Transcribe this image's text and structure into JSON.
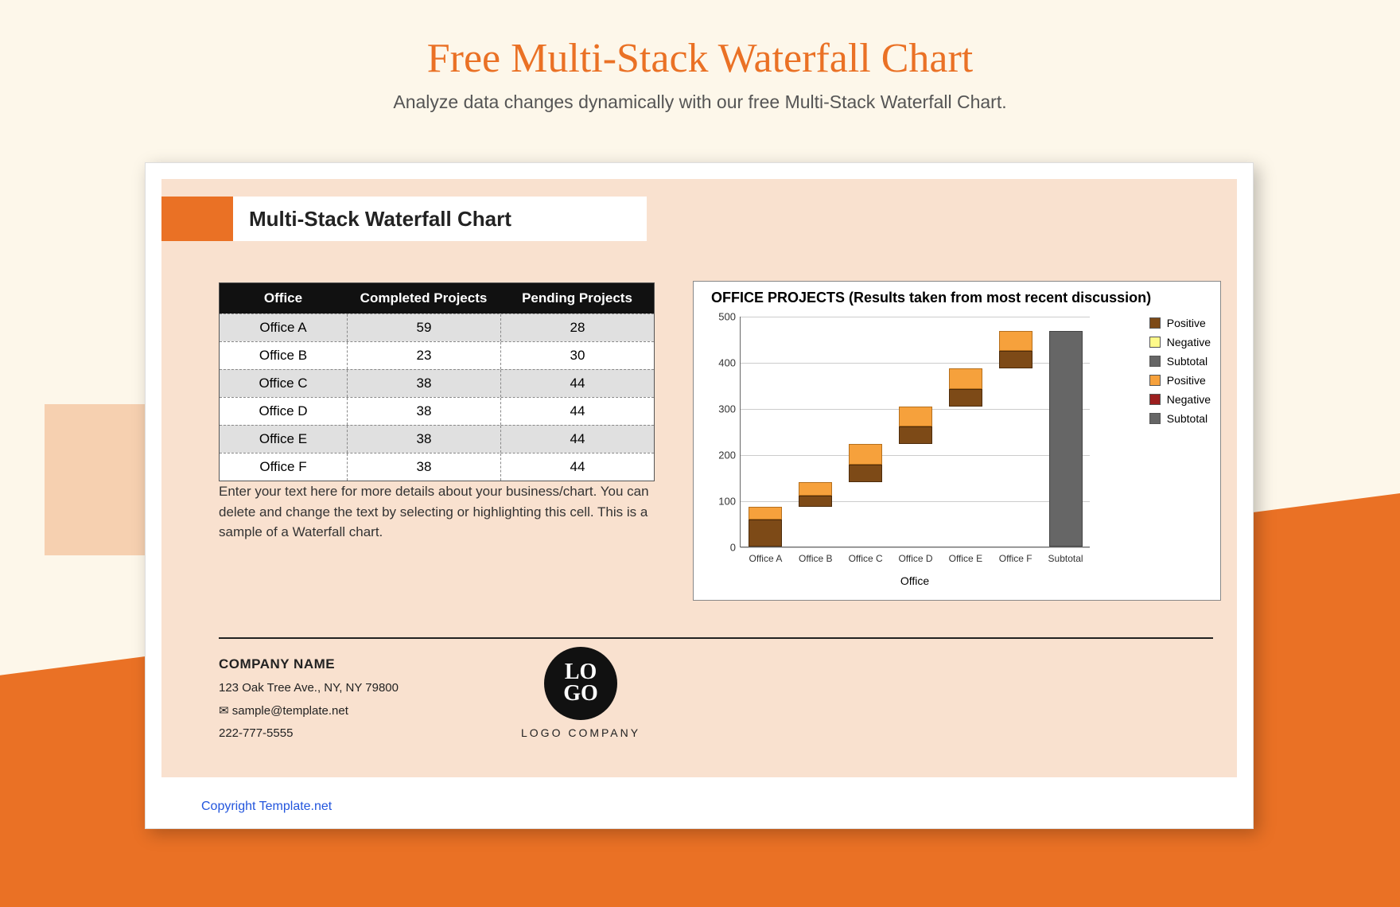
{
  "page": {
    "title": "Free Multi-Stack Waterfall Chart",
    "subtitle": "Analyze data changes dynamically with our free Multi-Stack Waterfall Chart."
  },
  "banner": {
    "label": "Multi-Stack Waterfall Chart"
  },
  "table": {
    "headers": [
      "Office",
      "Completed Projects",
      "Pending Projects"
    ],
    "rows": [
      {
        "office": "Office A",
        "completed": 59,
        "pending": 28
      },
      {
        "office": "Office B",
        "completed": 23,
        "pending": 30
      },
      {
        "office": "Office C",
        "completed": 38,
        "pending": 44
      },
      {
        "office": "Office D",
        "completed": 38,
        "pending": 44
      },
      {
        "office": "Office E",
        "completed": 38,
        "pending": 44
      },
      {
        "office": "Office F",
        "completed": 38,
        "pending": 44
      }
    ]
  },
  "note": "Enter your text here for more details about your business/chart. You can delete and change the text by selecting or highlighting this cell. This is a sample of a Waterfall chart.",
  "chart": {
    "title": "OFFICE PROJECTS (Results taken from most recent discussion)",
    "xaxis": "Office",
    "legend": [
      "Positive",
      "Negative",
      "Subtotal",
      "Positive",
      "Negative",
      "Subtotal"
    ]
  },
  "chart_data": {
    "type": "bar",
    "title": "OFFICE PROJECTS (Results taken from most recent discussion)",
    "xlabel": "Office",
    "ylabel": "",
    "ylim": [
      0,
      500
    ],
    "yticks": [
      0,
      100,
      200,
      300,
      400,
      500
    ],
    "categories": [
      "Office A",
      "Office B",
      "Office C",
      "Office D",
      "Office E",
      "Office F",
      "Subtotal"
    ],
    "series": [
      {
        "name": "Completed Projects (Positive)",
        "color": "#7d4a17",
        "values": [
          59,
          23,
          38,
          38,
          38,
          38,
          null
        ]
      },
      {
        "name": "Pending Projects (Positive)",
        "color": "#f6a13c",
        "values": [
          28,
          30,
          44,
          44,
          44,
          44,
          null
        ]
      },
      {
        "name": "Subtotal",
        "color": "#666666",
        "values": [
          null,
          null,
          null,
          null,
          null,
          null,
          468
        ]
      }
    ],
    "waterfall_bases": [
      0,
      87,
      140,
      222,
      304,
      386,
      0
    ],
    "legend_items": [
      {
        "name": "Positive",
        "color": "#7d4a17"
      },
      {
        "name": "Negative",
        "color": "#fffa8a"
      },
      {
        "name": "Subtotal",
        "color": "#666666"
      },
      {
        "name": "Positive",
        "color": "#f6a13c"
      },
      {
        "name": "Negative",
        "color": "#9c1f1f"
      },
      {
        "name": "Subtotal",
        "color": "#666666"
      }
    ]
  },
  "footer": {
    "company": "COMPANY NAME",
    "address": "123 Oak Tree Ave., NY, NY 79800",
    "email": "sample@template.net",
    "phone": "222-777-5555"
  },
  "logo": {
    "line1": "LO",
    "line2": "GO",
    "caption": "LOGO COMPANY"
  },
  "copyright": "Copyright Template.net"
}
